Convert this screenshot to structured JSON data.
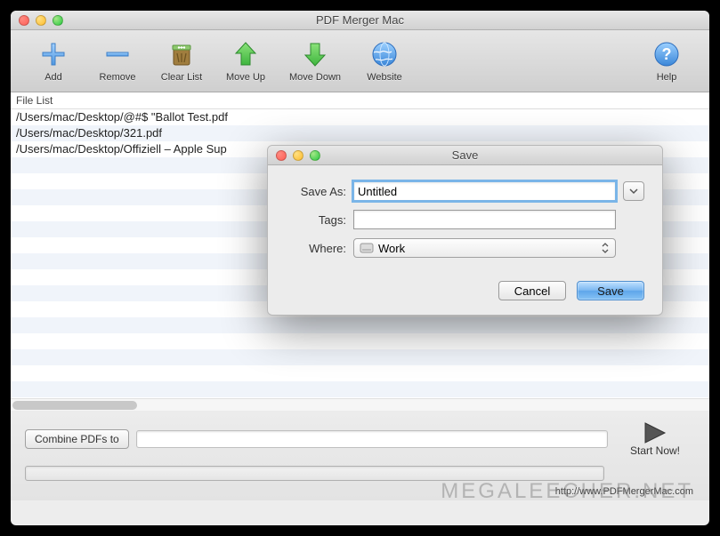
{
  "window": {
    "title": "PDF Merger Mac"
  },
  "toolbar": {
    "add": "Add",
    "remove": "Remove",
    "clear_list": "Clear List",
    "move_up": "Move Up",
    "move_down": "Move Down",
    "website": "Website",
    "help": "Help"
  },
  "filelist": {
    "header": "File List",
    "items": [
      "/Users/mac/Desktop/@#$ \"Ballot Test.pdf",
      "/Users/mac/Desktop/321.pdf",
      "/Users/mac/Desktop/Offiziell – Apple Sup"
    ]
  },
  "bottom": {
    "combine_label": "Combine PDFs to",
    "output_value": "",
    "start_label": "Start Now!",
    "footer_url": "http://www.PDFMergerMac.com"
  },
  "watermark": "MEGALEECHER.NET",
  "dialog": {
    "title": "Save",
    "save_as_label": "Save As:",
    "save_as_value": "Untitled",
    "tags_label": "Tags:",
    "tags_value": "",
    "where_label": "Where:",
    "where_value": "Work",
    "cancel": "Cancel",
    "save": "Save"
  }
}
